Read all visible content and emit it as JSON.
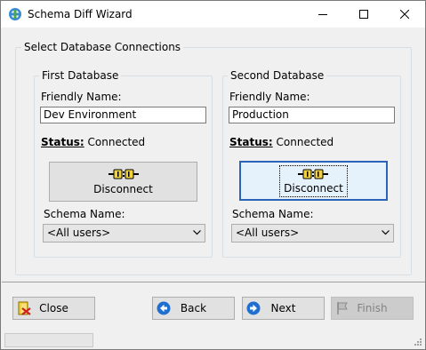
{
  "window": {
    "title": "Schema Diff Wizard",
    "icon": "schema-diff-app-icon",
    "controls": [
      "minimize-icon",
      "maximize-icon",
      "close-icon"
    ]
  },
  "connections": {
    "group_title": "Select Database Connections",
    "first": {
      "title": "First Database",
      "friendly_name_label": "Friendly Name:",
      "friendly_name_value": "Dev Environment",
      "status_label": "Status:",
      "status_value": "Connected",
      "disconnect_label": "Disconnect",
      "schema_label": "Schema Name:",
      "schema_selected": "<All users>"
    },
    "second": {
      "title": "Second Database",
      "friendly_name_label": "Friendly Name:",
      "friendly_name_value": "Production",
      "status_label": "Status:",
      "status_value": "Connected",
      "disconnect_label": "Disconnect",
      "schema_label": "Schema Name:",
      "schema_selected": "<All users>"
    }
  },
  "buttons": {
    "close": "Close",
    "back": "Back",
    "next": "Next",
    "finish": "Finish"
  },
  "colors": {
    "focus_border": "#2a64b8",
    "nav_icon_blue": "#1e6fd0",
    "disabled_text": "#838383"
  }
}
